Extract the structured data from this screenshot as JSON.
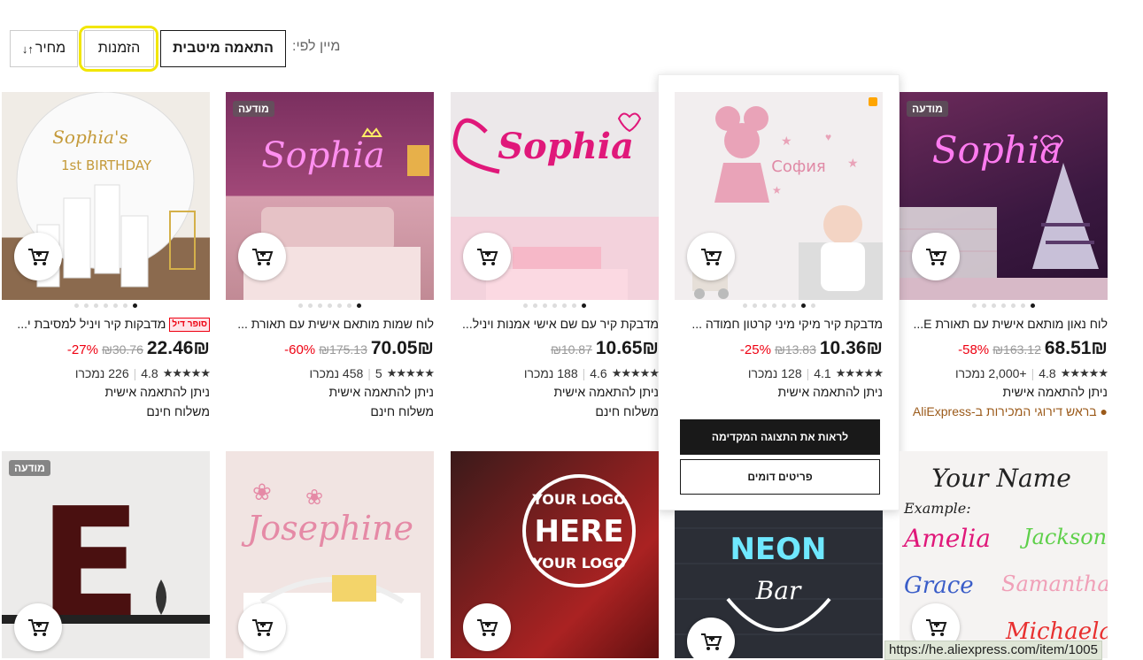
{
  "sort": {
    "label": "מיין לפי:",
    "options": [
      "התאמה מיטבית",
      "הזמנות",
      "מחיר"
    ],
    "price_arrows": "↑↓"
  },
  "products": [
    {
      "title": "לוח נאון מותאם אישית עם תאורת E...",
      "price": "68.51₪",
      "old_price": "₪163.12",
      "discount": "58%-",
      "rating": "4.8",
      "sold": "+2,000 נמכרו",
      "personal": "ניתן להתאמה אישית",
      "extra": "בראש דירוגי המכירות ב-AliExpress",
      "ad": "מודעה",
      "neon_text": "Sophia"
    },
    {
      "title": "מדבקת קיר מיקי מיני קרטון חמודה ...",
      "price": "10.36₪",
      "old_price": "₪13.83",
      "discount": "25%-",
      "rating": "4.1",
      "sold": "128 נמכרו",
      "personal": "ניתן להתאמה אישית",
      "extra": "",
      "img_text": "София"
    },
    {
      "title": "מדבקת קיר עם שם אישי אמנות ויניל...",
      "price": "10.65₪",
      "old_price": "₪10.87",
      "discount": "",
      "rating": "4.6",
      "sold": "188 נמכרו",
      "personal": "ניתן להתאמה אישית",
      "extra": "משלוח חינם",
      "img_text": "Sophia"
    },
    {
      "title": "לוח שמות מותאם אישית עם תאורת ...",
      "price": "70.05₪",
      "old_price": "₪175.13",
      "discount": "60%-",
      "rating": "5",
      "sold": "458 נמכרו",
      "personal": "ניתן להתאמה אישית",
      "extra": "משלוח חינם",
      "ad": "מודעה",
      "img_text": "Sophia"
    },
    {
      "title": "מדבקות קיר ויניל למסיבת י...",
      "super": "סופר דיל",
      "price": "22.46₪",
      "old_price": "₪30.76",
      "discount": "27%-",
      "rating": "4.8",
      "sold": "226 נמכרו",
      "personal": "ניתן להתאמה אישית",
      "extra": "משלוח חינם",
      "img_text": "Sophia's",
      "img_text2": "1st BIRTHDAY"
    }
  ],
  "row2": [
    {
      "ad": "",
      "lines": [
        "Your Name",
        "Example:",
        "Amelia",
        "Jackson",
        "Grace",
        "Samantha",
        "Michaela"
      ]
    },
    {
      "ad": "",
      "lines": [
        "NEON",
        "Bar"
      ]
    },
    {
      "ad": "",
      "lines": [
        "YOUR LOGO",
        "HERE",
        "YOUR LOGO"
      ]
    },
    {
      "ad": "",
      "lines": [
        "Josephine"
      ]
    },
    {
      "ad": "מודעה",
      "lines": [
        "E"
      ]
    }
  ],
  "popup": {
    "preview_button": "לראות את התצוגה המקדימה",
    "similar_button": "פריטים דומים"
  },
  "status_url": "https://he.aliexpress.com/item/1005"
}
